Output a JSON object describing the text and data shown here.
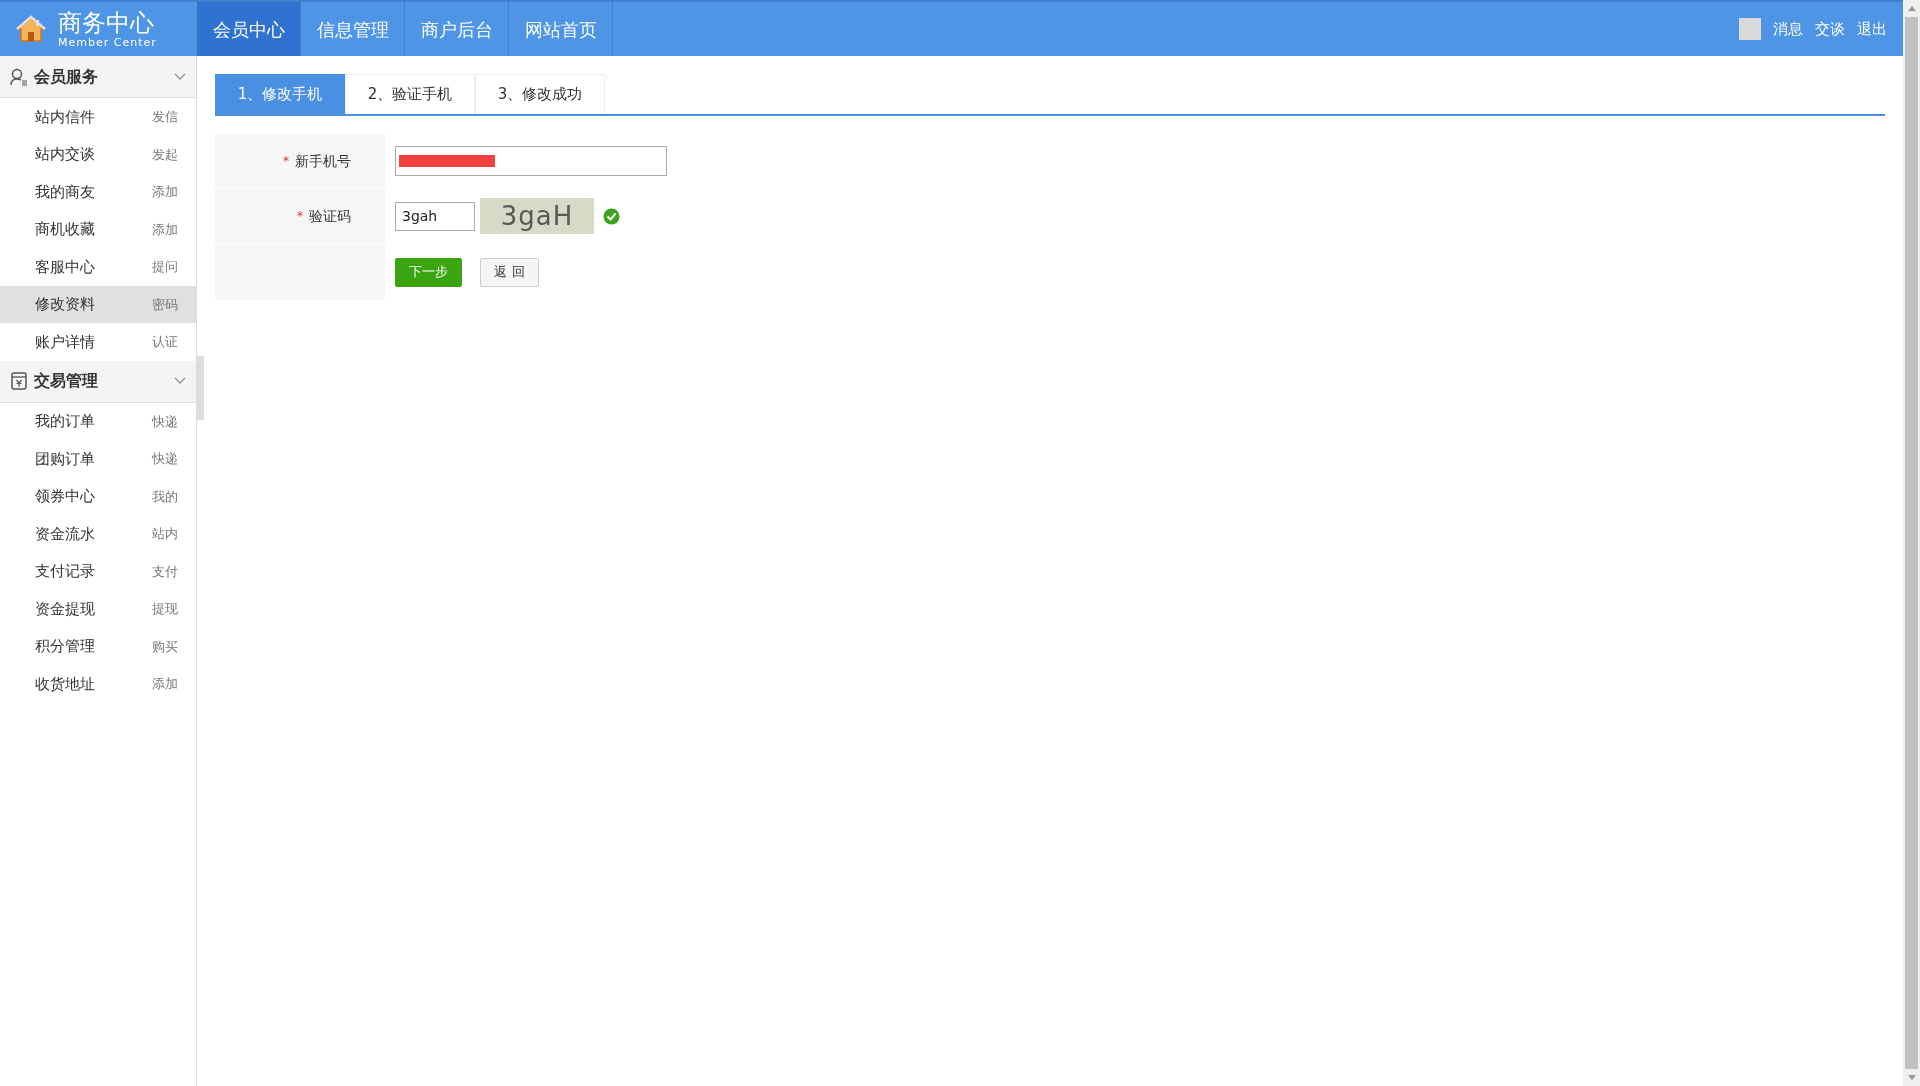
{
  "header": {
    "logo_title": "商务中心",
    "logo_subtitle": "Member Center",
    "nav": [
      {
        "label": "会员中心",
        "selected": true
      },
      {
        "label": "信息管理",
        "selected": false
      },
      {
        "label": "商户后台",
        "selected": false
      },
      {
        "label": "网站首页",
        "selected": false
      }
    ],
    "user_links": [
      "消息",
      "交谈",
      "退出"
    ]
  },
  "sidebar": {
    "sections": [
      {
        "kind": "user",
        "title": "会员服务",
        "expanded": true,
        "items": [
          {
            "label": "站内信件",
            "action": "发信",
            "selected": false
          },
          {
            "label": "站内交谈",
            "action": "发起",
            "selected": false
          },
          {
            "label": "我的商友",
            "action": "添加",
            "selected": false
          },
          {
            "label": "商机收藏",
            "action": "添加",
            "selected": false
          },
          {
            "label": "客服中心",
            "action": "提问",
            "selected": false
          },
          {
            "label": "修改资料",
            "action": "密码",
            "selected": true
          },
          {
            "label": "账户详情",
            "action": "认证",
            "selected": false
          }
        ]
      },
      {
        "kind": "trade",
        "title": "交易管理",
        "expanded": true,
        "items": [
          {
            "label": "我的订单",
            "action": "快递",
            "selected": false
          },
          {
            "label": "团购订单",
            "action": "快递",
            "selected": false
          },
          {
            "label": "领券中心",
            "action": "我的",
            "selected": false
          },
          {
            "label": "资金流水",
            "action": "站内",
            "selected": false
          },
          {
            "label": "支付记录",
            "action": "支付",
            "selected": false
          },
          {
            "label": "资金提现",
            "action": "提现",
            "selected": false
          },
          {
            "label": "积分管理",
            "action": "购买",
            "selected": false
          },
          {
            "label": "收货地址",
            "action": "添加",
            "selected": false
          }
        ]
      }
    ]
  },
  "steps": [
    {
      "label": "1、修改手机",
      "selected": true
    },
    {
      "label": "2、验证手机",
      "selected": false
    },
    {
      "label": "3、修改成功",
      "selected": false
    }
  ],
  "form": {
    "rows": [
      {
        "kind": "phone",
        "required_mark": "*",
        "label": "新手机号",
        "redacted": true
      },
      {
        "kind": "captcha",
        "required_mark": "*",
        "label": "验证码",
        "value": "3gah",
        "captcha_text": "3gaH",
        "valid": true
      }
    ],
    "buttons": [
      {
        "kind": "primary",
        "label": "下一步"
      },
      {
        "kind": "secondary",
        "label": "返 回"
      }
    ]
  }
}
